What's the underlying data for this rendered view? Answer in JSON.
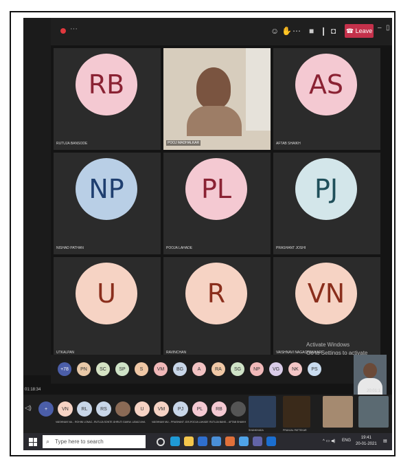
{
  "topbar": {
    "more_label": "···",
    "leave_label": "Leave",
    "minimize": "–",
    "restore": "▯",
    "close": "×"
  },
  "tiles": [
    {
      "initials": "RB",
      "name": "RUTUJA BANSODE",
      "bg": "#f4c9d2",
      "fg": "#8a2233",
      "video": false
    },
    {
      "initials": "",
      "name": "POOJ MADHALKAR",
      "video": true
    },
    {
      "initials": "AS",
      "name": "AFTAB SHAIKH",
      "bg": "#f4c9d2",
      "fg": "#8a2233",
      "video": false
    },
    {
      "initials": "NP",
      "name": "NISHAD PATHAN",
      "bg": "#b9cfe6",
      "fg": "#1f3f70",
      "video": false
    },
    {
      "initials": "PL",
      "name": "POOJA LAHADE",
      "bg": "#f4c9d2",
      "fg": "#8a2233",
      "video": false
    },
    {
      "initials": "PJ",
      "name": "PRASHANT JOSHI",
      "bg": "#d3e6ea",
      "fg": "#1f4f5a",
      "video": false
    },
    {
      "initials": "U",
      "name": "UTKALPAN",
      "bg": "#f6d3c4",
      "fg": "#8a2e1c",
      "video": false
    },
    {
      "initials": "R",
      "name": "RAVINCHAN",
      "bg": "#f6d3c4",
      "fg": "#8a2e1c",
      "video": false
    },
    {
      "initials": "VN",
      "name": "VAISHNAVI NAGACHANKARI",
      "bg": "#f6d3c4",
      "fg": "#8a2e1c",
      "video": false
    }
  ],
  "strip": [
    {
      "label": "+78",
      "bg": "#4b5ea8"
    },
    {
      "label": "PN",
      "bg": "#e9c9a8"
    },
    {
      "label": "SC",
      "bg": "#d5e3c4"
    },
    {
      "label": "SP",
      "bg": "#cfe3c7"
    },
    {
      "label": "S",
      "bg": "#f0c8a6"
    },
    {
      "label": "VM",
      "bg": "#f0b8b8"
    },
    {
      "label": "BG",
      "bg": "#c8d6e8"
    },
    {
      "label": "A",
      "bg": "#f1c2c2"
    },
    {
      "label": "RA",
      "bg": "#f0c8a6"
    },
    {
      "label": "SG",
      "bg": "#cfe3c7"
    },
    {
      "label": "NP",
      "bg": "#f1b9b9"
    },
    {
      "label": "VG",
      "bg": "#d9cce8"
    },
    {
      "label": "NK",
      "bg": "#f3c6c6"
    },
    {
      "label": "PS",
      "bg": "#c9dcef"
    }
  ],
  "watermark": {
    "line1": "Activate Windows",
    "line2": "Go to Settings to activate Windows."
  },
  "time_left": "01:18:34",
  "time_right": "20:01:1",
  "taskrow": [
    {
      "label": "VN",
      "name": "VAISHNAVI NA...",
      "bg": "#f6d3c4"
    },
    {
      "label": "RL",
      "name": "ROHINI LONAC...",
      "bg": "#c8d6e8"
    },
    {
      "label": "RS",
      "name": "RUTUJA SONTE...",
      "bg": "#c8d6e8"
    },
    {
      "label": "",
      "name": "SHRUTI GAIKW...",
      "bg": "#8a6a55"
    },
    {
      "label": "U",
      "name": "UDAIZ AHA",
      "bg": "#f6d3c4"
    },
    {
      "label": "VM",
      "name": "VAISHNAVI MU...",
      "bg": "#f6d3c4"
    },
    {
      "label": "PJ",
      "name": "PRASHANT JOS...",
      "bg": "#c8d6e8"
    },
    {
      "label": "PL",
      "name": "POOJA LAHADE",
      "bg": "#f4c9d2"
    },
    {
      "label": "RB",
      "name": "RUTUJA BANS...",
      "bg": "#f4c9d2"
    },
    {
      "label": "",
      "name": "AFTAB SHAIKH",
      "bg": "#555"
    }
  ],
  "extra_thumbs": [
    {
      "name": "SHANKHADA"
    },
    {
      "name": "PRANJAL PATTEKAR"
    }
  ],
  "taskbar": {
    "search_placeholder": "Type here to search",
    "lang": "ENG",
    "time": "19:41",
    "date": "20-01-2021"
  }
}
